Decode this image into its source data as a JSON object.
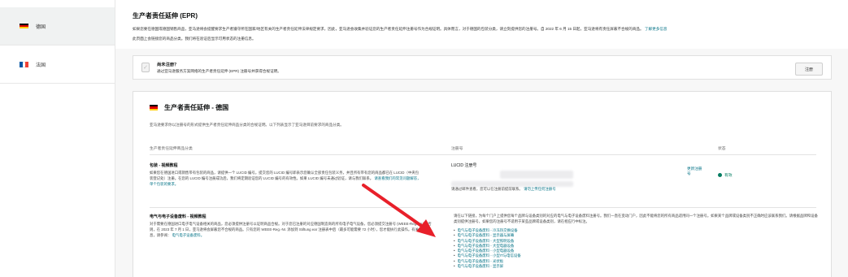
{
  "sidebar": {
    "items": [
      {
        "label": "德国",
        "flag": [
          "#000000",
          "#dd0000",
          "#ffce00"
        ],
        "active": true
      },
      {
        "label": "法国",
        "flag": [
          "#0055a4",
          "#ffffff",
          "#ef4135"
        ],
        "active": false
      }
    ]
  },
  "header": {
    "title": "生产者责任延伸 (EPR)",
    "desc_line1": "如果您要在德国或德国销售商品，亚马逊将会提醒要求生产者遵守所在国家/地区有关的生产者责任延伸法律规定要求，因此，亚马逊会收集并验证您的生产者责任延伸注册号作为合规证明。具体而言，对于德国的包装分类，请立刻提供您的注册号。自 2022 年 6 月 15 日起，亚马逊将有责任屏蔽不合规的商品。",
    "desc_link": "了解更多信息",
    "desc_line2": "此页面上会链接您的商品分类。我们将在验证后显示可用状态的注册信息。"
  },
  "notice": {
    "title": "尚未注册？",
    "subtitle": "通过亚马逊服务方案网络的生产者责任延伸 (EPR) 注册号并获得合规证明。",
    "button": "注册"
  },
  "card": {
    "flag": [
      "#000000",
      "#dd0000",
      "#ffce00"
    ],
    "title": "生产者责任延伸 - 德国",
    "desc": "亚马逊要求你以注册号的形式提供生产者责任延伸商品分类的合规证明。以下列表显示了亚马逊目前要求的商品分类。",
    "col_category": "生产者责任延伸商品分类",
    "col_number": "注册号",
    "col_status": "状态",
    "rows": [
      {
        "title": "包装 - 视频教程",
        "desc": "如果您在德国进口或销售带有包装的商品，请提供一个 LUCID 编号。提交您的 LUCID 编号即表示您确认全部责任包装义务，并且所有带有您的商品都已在 LUCID（中央包装登记处）注册。在您的 LUCID 编号注册成功后，我们将定期验证您的 LUCID 编号的有效性。如果 LUCID 编号未通过验证，请与我们联系。",
        "desc_link": "请查看我们的常见问题解答，单个包装的要求。",
        "number_label": "LUCID 注册号",
        "number_note": "请通过邮件查看，您可以在注册前提前联系。",
        "number_link": "请勿上传任何注册号",
        "update_link": "更新注册号",
        "status": "有效"
      },
      {
        "title": "电气与电子设备废料 - 视频教程",
        "desc": "对于需要在德国进口电子电气设备相关的商品，您必须提供注册号以证明商品合规。对于您已注册的对应德国制造商的所有电子电气设备，您必须提交注册号 (WEEE-Reg.-Nr.)。否则，在 2023 年 7 月 1 日，亚马逊将会屏蔽您不合规的商品。只有您的 WEEE-Reg.-Nr. 添加到 Stiftung ear 注册表中后（最多可能需要 72 小时），您才能执行此操作。有关详细信息，请参阅：",
        "desc_link": "电气电子设备废料。",
        "number_desc": "请在以下链接，为每个门户上提供您每个品牌与设备类别的对应的电气与电子设备废料注册号。我们一直在变动门户，因此不能将您的所有商品适用同一个注册号。如果某个品牌或设备类别不正确时应该联系我们。请根据品牌和设备类别提供注册号，如果您的注册号不适用于某些品牌或设备类别，请在相应行中标注。"
      }
    ],
    "weee_links": [
      "电气与电子设备废料 - 冷冻热交换设备",
      "电气与电子设备废料 - 显示器与屏幕",
      "电气与电子设备废料 - 大型照明设备",
      "电气与电子设备废料 - 大型电器设备",
      "电气与电子设备废料 - 小型电器设备",
      "电气与电子设备废料 - 小型IT与电信设备",
      "电气与电子设备废料 - 光伏板",
      "电气与电子设备废料 - 显示屏"
    ]
  },
  "colors": {
    "link": "#007185",
    "status_green": "#067d62",
    "arrow": "#e8202a"
  }
}
